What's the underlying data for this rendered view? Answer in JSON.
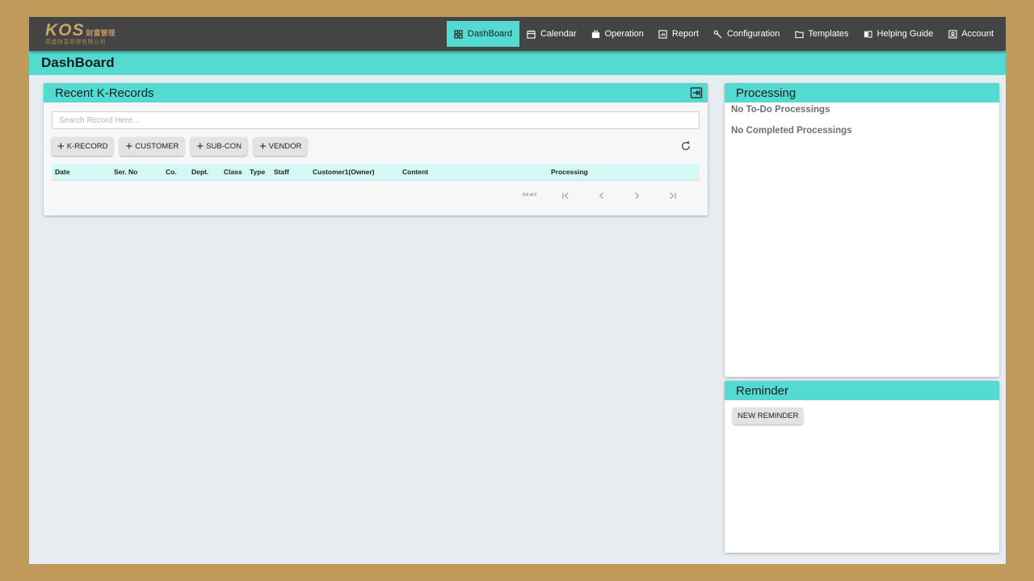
{
  "header": {
    "logo_main": "KOS",
    "logo_side": "財富管理",
    "logo_sub": "高盛財富管理有限公司",
    "nav": [
      {
        "label": "DashBoard",
        "icon": "dashboard-icon",
        "active": true
      },
      {
        "label": "Calendar",
        "icon": "calendar-icon"
      },
      {
        "label": "Operation",
        "icon": "briefcase-icon"
      },
      {
        "label": "Report",
        "icon": "report-icon"
      },
      {
        "label": "Configuration",
        "icon": "wrench-icon"
      },
      {
        "label": "Templates",
        "icon": "folder-icon"
      },
      {
        "label": "Helping Guide",
        "icon": "book-icon"
      },
      {
        "label": "Account",
        "icon": "account-icon"
      }
    ]
  },
  "page": {
    "title": "DashBoard"
  },
  "records": {
    "title": "Recent K-Records",
    "search_placeholder": "Search Record Here...",
    "buttons": [
      "K-RECORD",
      "CUSTOMER",
      "SUB-CON",
      "VENDOR"
    ],
    "columns": [
      "Date",
      "Ser. No",
      "Co.",
      "Dept.",
      "Class",
      "Type",
      "Staff",
      "Customer1(Owner)",
      "Content",
      "Processing"
    ],
    "pager_text": "0-0 of 0"
  },
  "processing": {
    "title": "Processing",
    "todo_text": "No To-Do Processings",
    "completed_text": "No Completed Processings"
  },
  "reminder": {
    "title": "Reminder",
    "new_button": "NEW REMINDER"
  },
  "colors": {
    "accent": "#53dbd2",
    "topbar": "#444444",
    "frame": "#c09a5b"
  }
}
